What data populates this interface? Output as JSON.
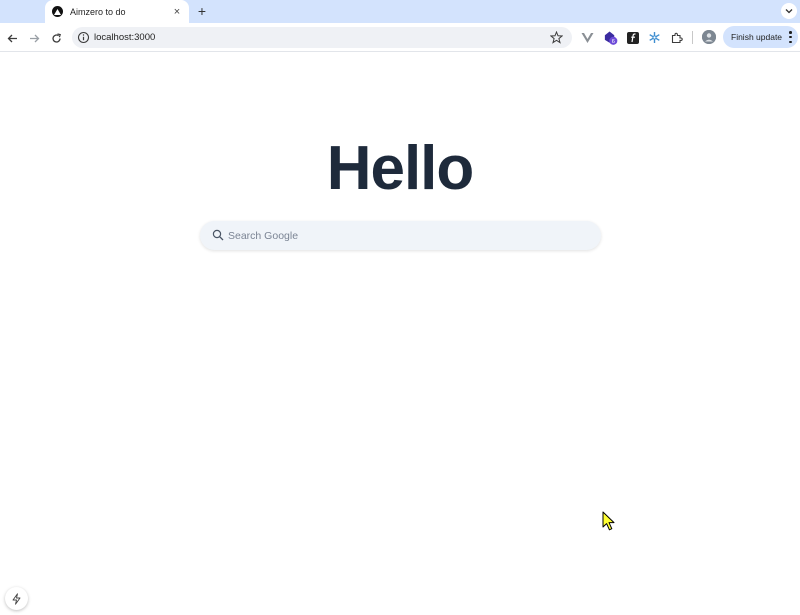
{
  "browser": {
    "tab": {
      "title": "Aimzero to do",
      "close_label": "×"
    },
    "new_tab_label": "+",
    "address": {
      "url": "localhost:3000"
    },
    "extensions": [
      "vue-devtools-icon",
      "shield-badge-icon",
      "font-f-icon",
      "snowflake-icon",
      "puzzle-icon"
    ],
    "extension_badge": "6",
    "profile_avatar": "profile-avatar",
    "update_button_label": "Finish update"
  },
  "page": {
    "heading": "Hello",
    "search": {
      "placeholder": "Search Google",
      "value": ""
    }
  },
  "colors": {
    "tabstrip": "#d3e3fd",
    "heading": "#1e2a3b",
    "search_bg": "#f0f4f9",
    "cursor": "#ffff33"
  }
}
